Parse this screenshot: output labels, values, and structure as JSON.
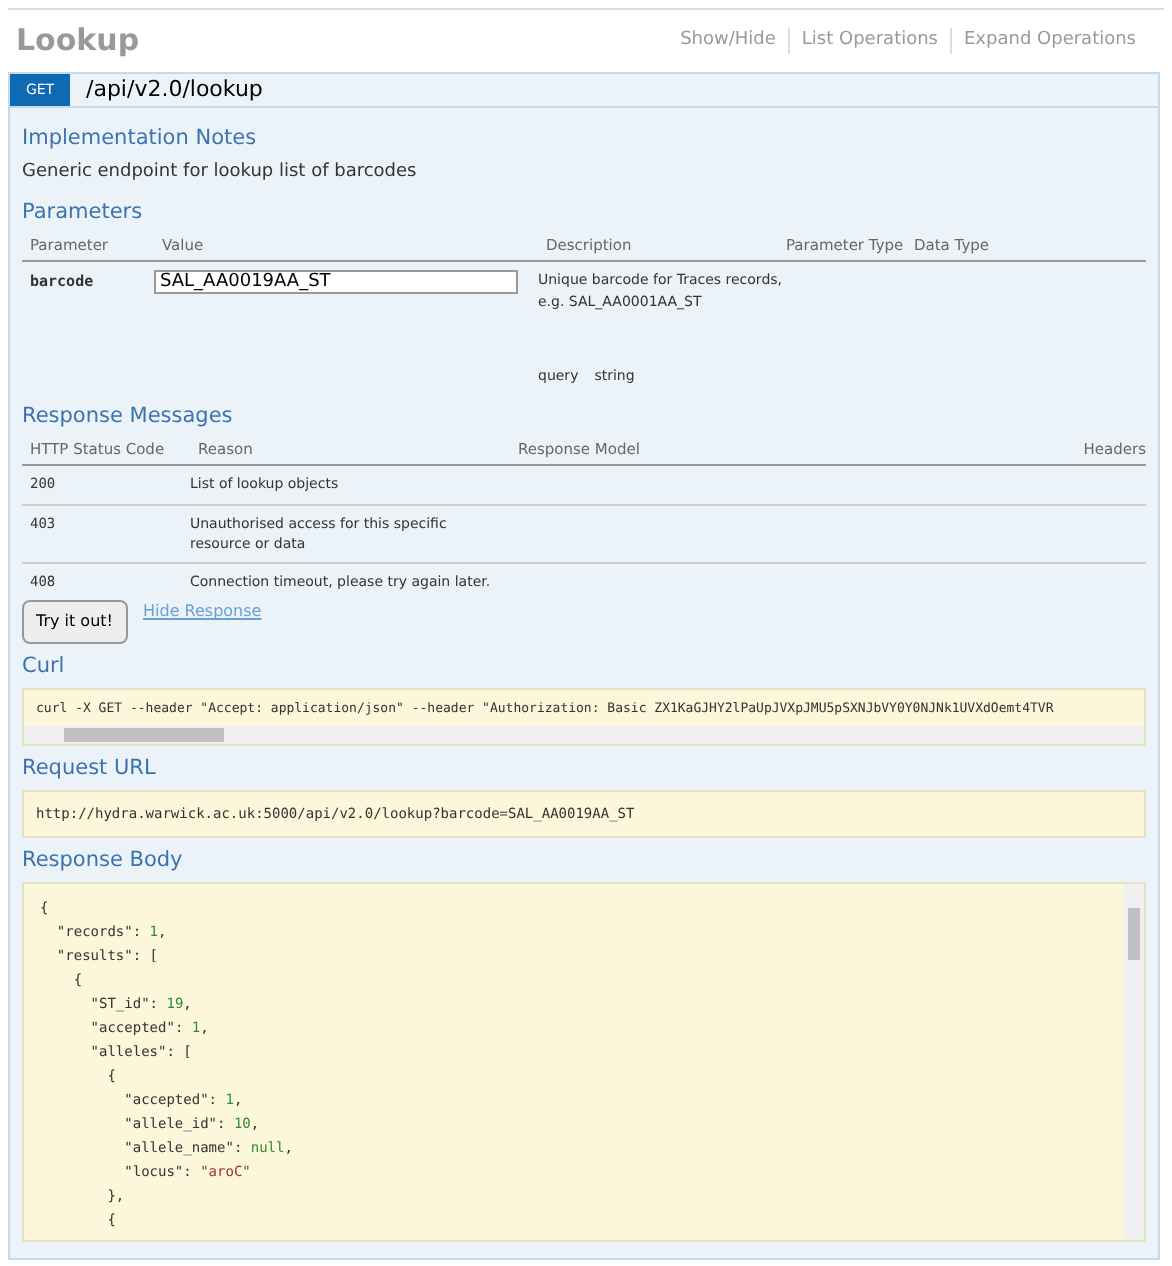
{
  "header": {
    "title": "Lookup",
    "links": [
      "Show/Hide",
      "List Operations",
      "Expand Operations"
    ]
  },
  "operation": {
    "method": "GET",
    "path": "/api/v2.0/lookup"
  },
  "notes": {
    "title": "Implementation Notes",
    "text": "Generic endpoint for lookup list of barcodes"
  },
  "parameters": {
    "title": "Parameters",
    "columns": [
      "Parameter",
      "Value",
      "Description",
      "Parameter Type",
      "Data Type"
    ],
    "rows": [
      {
        "name": "barcode",
        "value": "SAL_AA0019AA_ST",
        "description": "Unique barcode for Traces records, e.g. SAL_AA0001AA_ST",
        "param_type": "query",
        "data_type": "string"
      }
    ]
  },
  "responses": {
    "title": "Response Messages",
    "columns": [
      "HTTP Status Code",
      "Reason",
      "Response Model",
      "Headers"
    ],
    "rows": [
      {
        "code": "200",
        "reason": "List of lookup objects"
      },
      {
        "code": "403",
        "reason": "Unauthorised access for this specific resource or data"
      },
      {
        "code": "408",
        "reason": "Connection timeout, please try again later."
      }
    ]
  },
  "try_button": "Try it out!",
  "hide_link": "Hide Response",
  "curl": {
    "title": "Curl",
    "command": "curl -X GET --header \"Accept: application/json\" --header \"Authorization: Basic ZX1KaGJHY2lPaUpJVXpJMU5pSXNJbVY0Y0NJNk1UVXdOemt4TVR"
  },
  "request_url": {
    "title": "Request URL",
    "url": "http://hydra.warwick.ac.uk:5000/api/v2.0/lookup?barcode=SAL_AA0019AA_ST"
  },
  "response_body": {
    "title": "Response Body",
    "lines": [
      [
        {
          "kind": "punct",
          "text": "{"
        }
      ],
      [
        {
          "kind": "key",
          "text": "  \"records\""
        },
        {
          "kind": "punct",
          "text": ": "
        },
        {
          "kind": "number",
          "text": "1"
        },
        {
          "kind": "punct",
          "text": ","
        }
      ],
      [
        {
          "kind": "key",
          "text": "  \"results\""
        },
        {
          "kind": "punct",
          "text": ": ["
        }
      ],
      [
        {
          "kind": "punct",
          "text": "    {"
        }
      ],
      [
        {
          "kind": "key",
          "text": "      \"ST_id\""
        },
        {
          "kind": "punct",
          "text": ": "
        },
        {
          "kind": "number",
          "text": "19"
        },
        {
          "kind": "punct",
          "text": ","
        }
      ],
      [
        {
          "kind": "key",
          "text": "      \"accepted\""
        },
        {
          "kind": "punct",
          "text": ": "
        },
        {
          "kind": "number",
          "text": "1"
        },
        {
          "kind": "punct",
          "text": ","
        }
      ],
      [
        {
          "kind": "key",
          "text": "      \"alleles\""
        },
        {
          "kind": "punct",
          "text": ": ["
        }
      ],
      [
        {
          "kind": "punct",
          "text": "        {"
        }
      ],
      [
        {
          "kind": "key",
          "text": "          \"accepted\""
        },
        {
          "kind": "punct",
          "text": ": "
        },
        {
          "kind": "number",
          "text": "1"
        },
        {
          "kind": "punct",
          "text": ","
        }
      ],
      [
        {
          "kind": "key",
          "text": "          \"allele_id\""
        },
        {
          "kind": "punct",
          "text": ": "
        },
        {
          "kind": "number",
          "text": "10"
        },
        {
          "kind": "punct",
          "text": ","
        }
      ],
      [
        {
          "kind": "key",
          "text": "          \"allele_name\""
        },
        {
          "kind": "punct",
          "text": ": "
        },
        {
          "kind": "null",
          "text": "null"
        },
        {
          "kind": "punct",
          "text": ","
        }
      ],
      [
        {
          "kind": "key",
          "text": "          \"locus\""
        },
        {
          "kind": "punct",
          "text": ": "
        },
        {
          "kind": "string",
          "text": "\"aroC\""
        }
      ],
      [
        {
          "kind": "punct",
          "text": "        },"
        }
      ],
      [
        {
          "kind": "punct",
          "text": "        {"
        }
      ]
    ]
  }
}
